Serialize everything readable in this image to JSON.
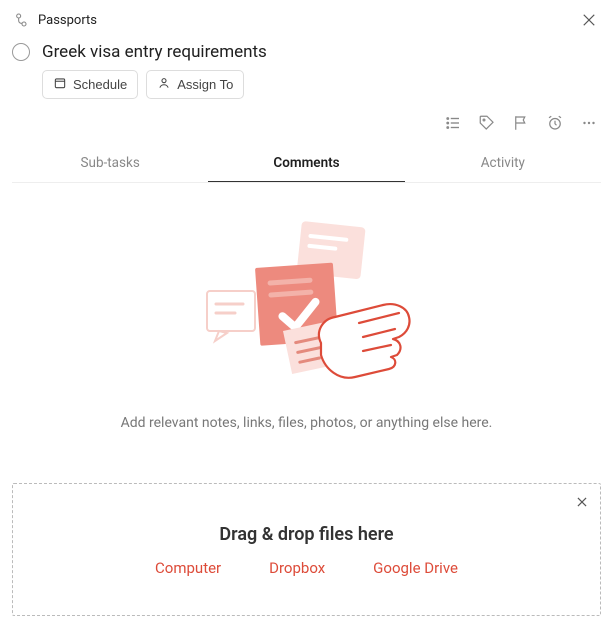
{
  "breadcrumb": {
    "label": "Passports"
  },
  "task": {
    "title": "Greek visa entry requirements"
  },
  "actions": {
    "schedule": "Schedule",
    "assign": "Assign To"
  },
  "tabs": {
    "subtasks": "Sub-tasks",
    "comments": "Comments",
    "activity": "Activity"
  },
  "empty": {
    "text": "Add relevant notes, links, files, photos, or anything else here."
  },
  "dropzone": {
    "title": "Drag & drop files here",
    "links": {
      "computer": "Computer",
      "dropbox": "Dropbox",
      "gdrive": "Google Drive"
    }
  }
}
